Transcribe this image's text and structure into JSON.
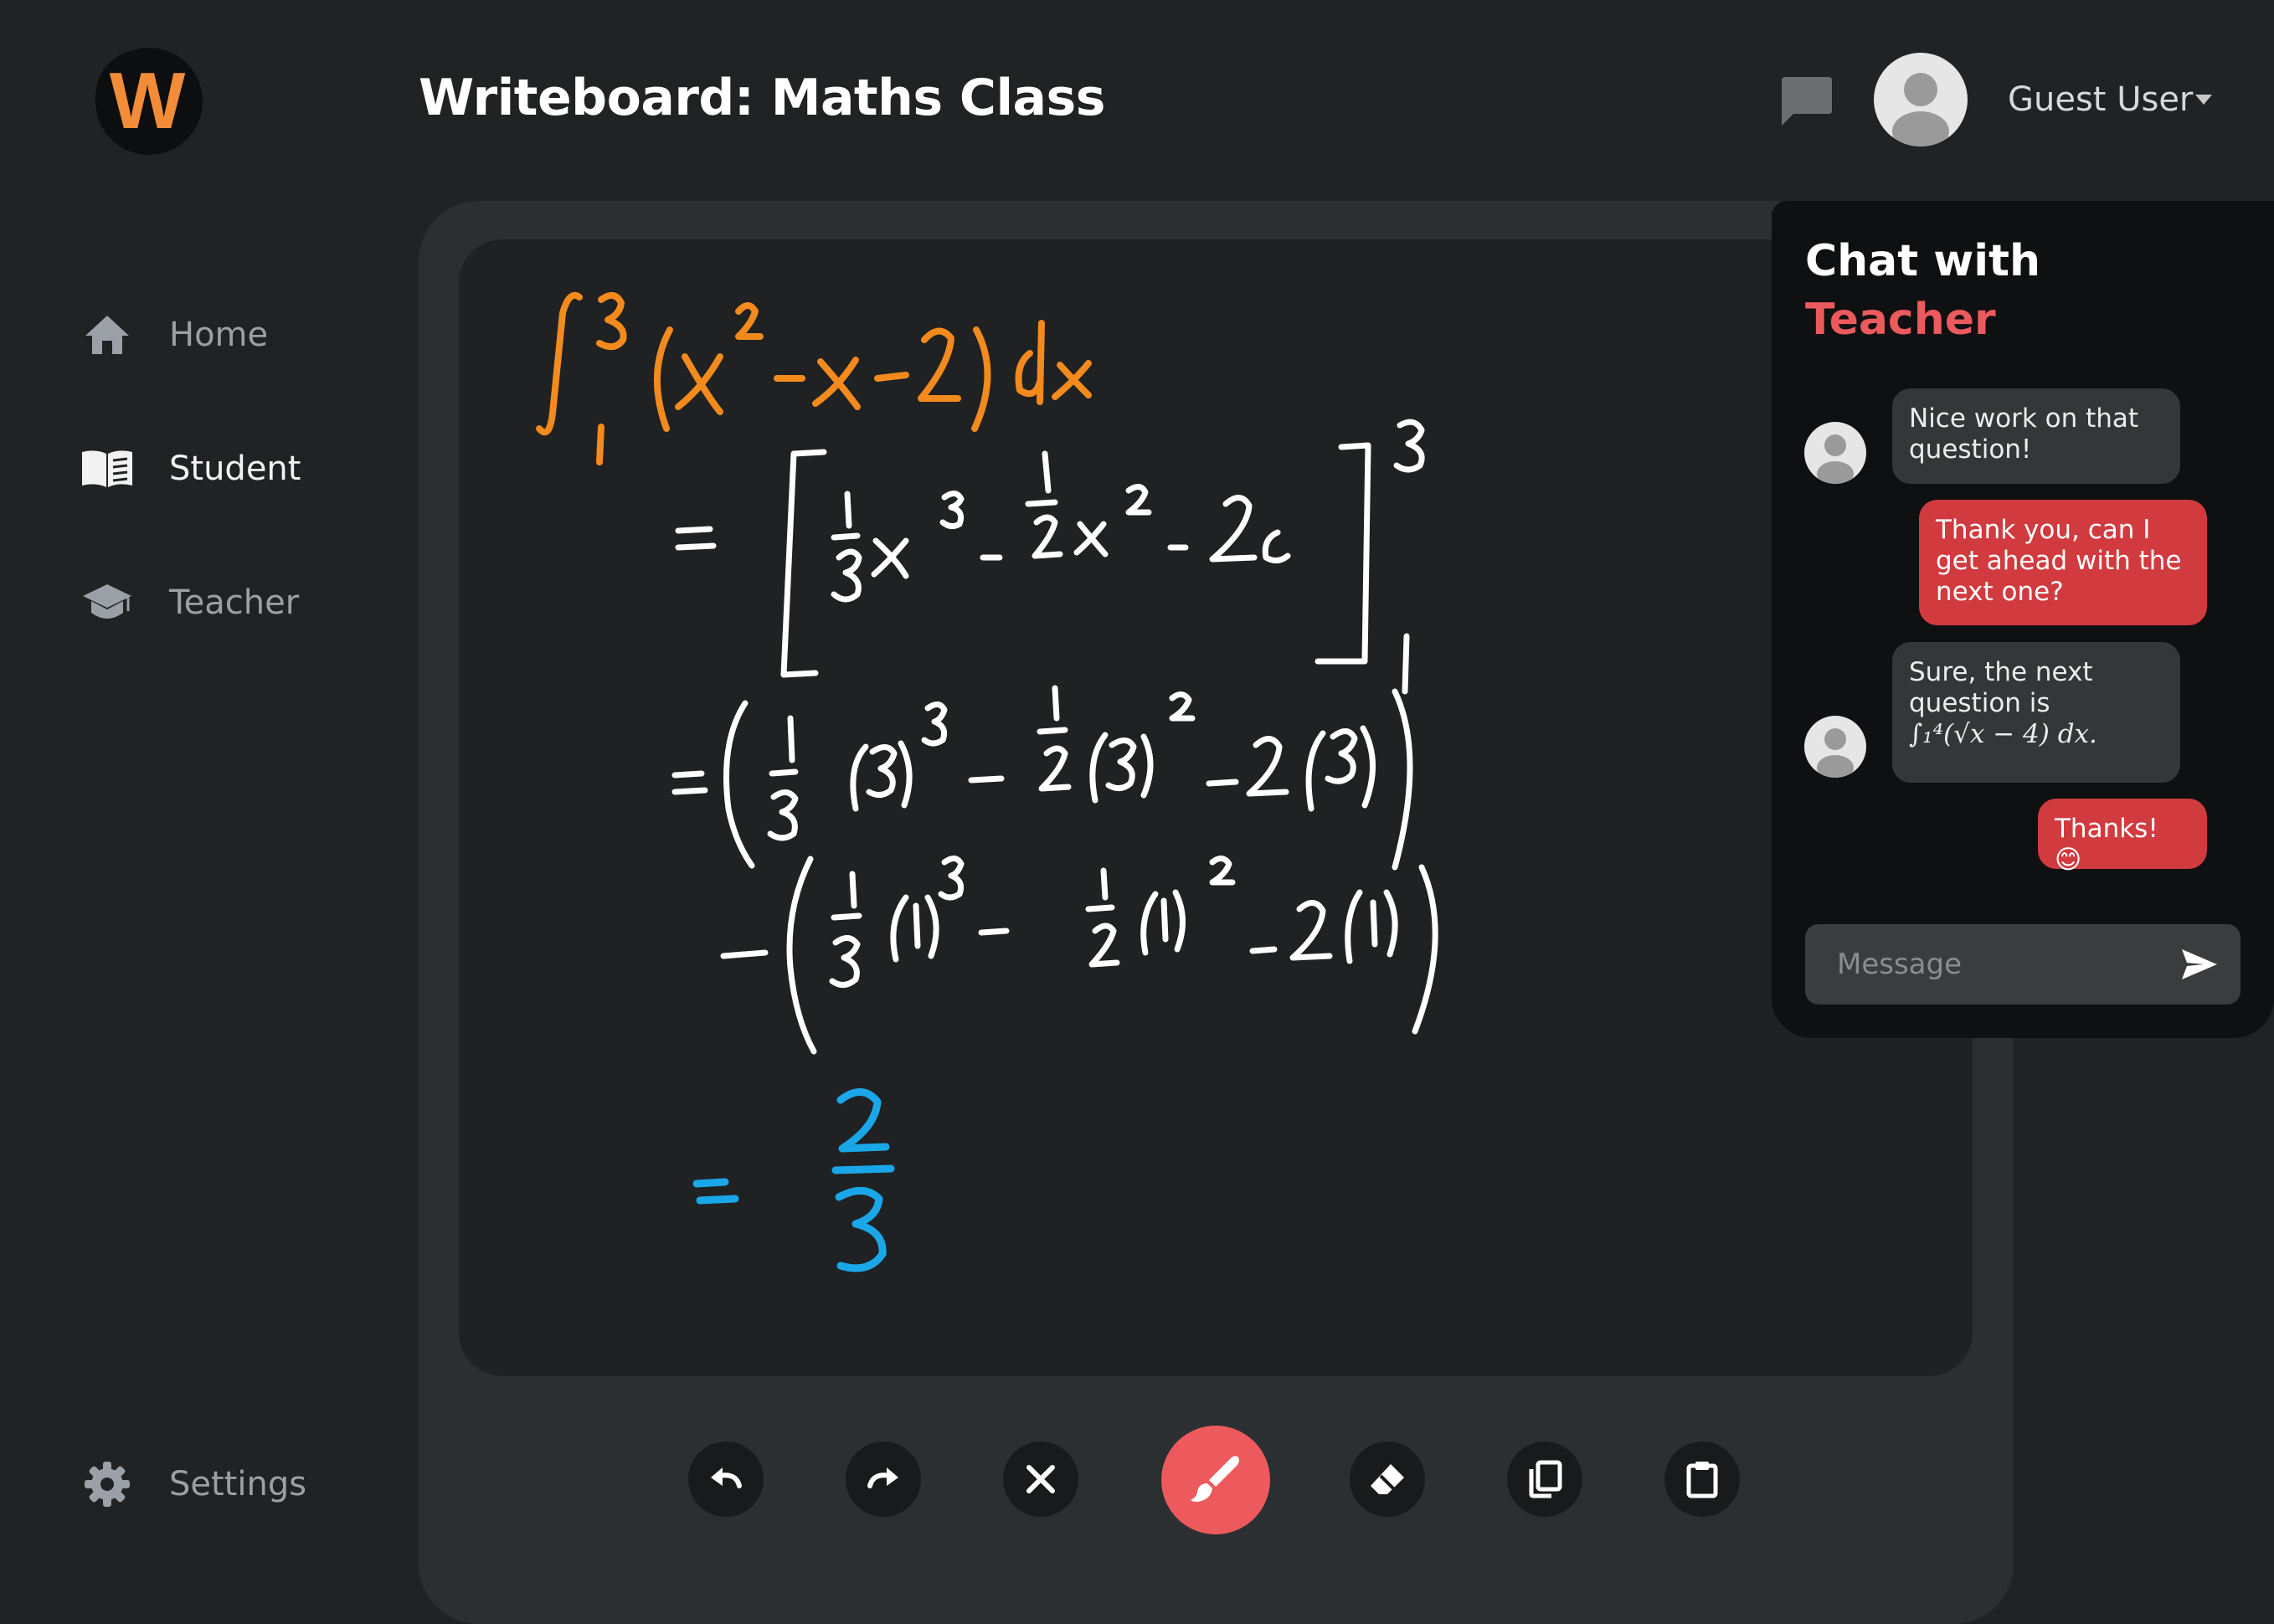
{
  "app": {
    "logo_letter": "W",
    "title": "Writeboard: Maths Class",
    "accent": "#ec5a5e",
    "logo_color": "#f28c38"
  },
  "header": {
    "chat_icon": "chat-bubble-icon",
    "user": {
      "name": "Guest User",
      "avatar_icon": "user-avatar-icon",
      "menu_icon": "caret-down-icon"
    }
  },
  "sidebar": {
    "items": [
      {
        "label": "Home",
        "icon": "home-icon",
        "active": false
      },
      {
        "label": "Student",
        "icon": "book-icon",
        "active": true
      },
      {
        "label": "Teacher",
        "icon": "graduation-cap-icon",
        "active": false
      }
    ],
    "settings": {
      "label": "Settings",
      "icon": "gear-icon"
    }
  },
  "board": {
    "ink_colors": {
      "problem": "#f28a1e",
      "work": "#ffffff",
      "answer": "#1aa7e8"
    },
    "handwriting": [
      "∫₁³ (x² − x − 2) dx",
      "= [ 1/3 x³ − 1/2 x² − 2x ]₁³",
      "= ( 1/3 (3)³ − 1/2 (3)² − 2(3) )",
      "− ( 1/3 (1)³ − 1/2 (1)² − 2(1) )",
      "= 2/3"
    ]
  },
  "toolbar": {
    "tools": [
      {
        "name": "undo",
        "icon": "undo-icon"
      },
      {
        "name": "redo",
        "icon": "redo-icon"
      },
      {
        "name": "clear",
        "icon": "close-icon"
      },
      {
        "name": "brush",
        "icon": "brush-icon",
        "selected": true
      },
      {
        "name": "eraser",
        "icon": "eraser-icon"
      },
      {
        "name": "copy",
        "icon": "copy-icon"
      },
      {
        "name": "paste",
        "icon": "clipboard-icon"
      }
    ]
  },
  "chat": {
    "title_line1": "Chat with",
    "title_line2": "Teacher",
    "messages": [
      {
        "from": "teacher",
        "text": "Nice work on that question!"
      },
      {
        "from": "student",
        "text": "Thank you, can I get ahead with the next one?"
      },
      {
        "from": "teacher",
        "text": "Sure, the next question is",
        "math": "∫₁⁴(√x − 4) dx."
      },
      {
        "from": "student",
        "text": "Thanks! 😊"
      }
    ],
    "input_placeholder": "Message",
    "send_icon": "send-icon"
  }
}
